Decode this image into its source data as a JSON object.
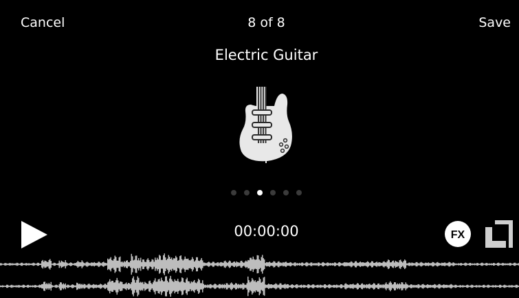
{
  "topbar": {
    "cancel_label": "Cancel",
    "counter": "8 of 8",
    "save_label": "Save"
  },
  "instrument": {
    "name": "Electric Guitar",
    "icon": "electric-guitar-icon"
  },
  "pager": {
    "count": 6,
    "active_index": 2
  },
  "transport": {
    "time": "00:00:00",
    "play_icon": "play-icon",
    "fx_label": "FX",
    "trim_icon": "trim-icon"
  },
  "colors": {
    "background": "#000000",
    "foreground": "#ffffff",
    "waveform": "#bdbdbd",
    "dot_inactive": "#3b3b3b"
  }
}
